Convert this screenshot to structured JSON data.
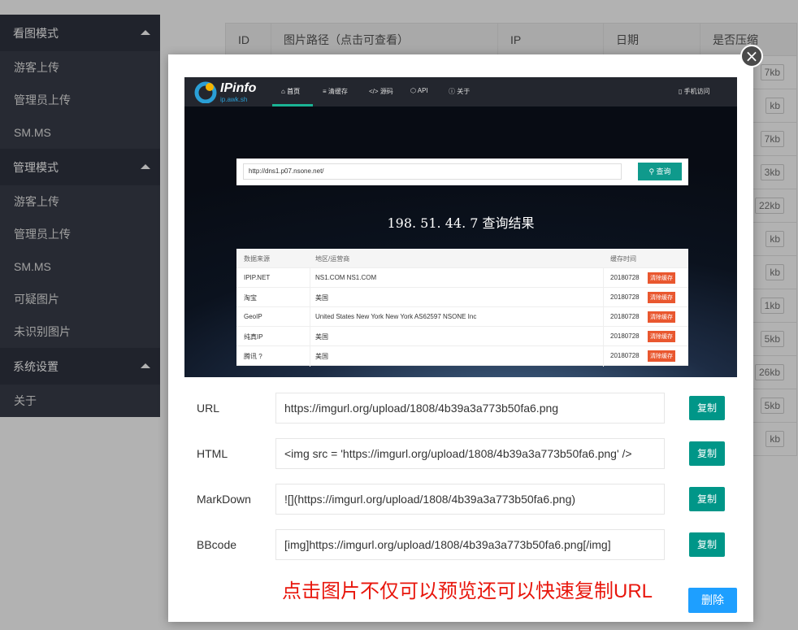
{
  "sidebar": {
    "groups": [
      {
        "title": "看图模式",
        "items": [
          "游客上传",
          "管理员上传",
          "SM.MS"
        ]
      },
      {
        "title": "管理模式",
        "items": [
          "游客上传",
          "管理员上传",
          "SM.MS",
          "可疑图片",
          "未识别图片"
        ]
      },
      {
        "title": "系统设置",
        "items": [
          "关于"
        ]
      }
    ]
  },
  "table": {
    "headers": [
      "ID",
      "图片路径（点击可查看）",
      "IP",
      "日期",
      "是否压缩"
    ],
    "size_tags": [
      "7kb",
      "kb",
      "7kb",
      "3kb",
      "22kb",
      "kb",
      "kb",
      "1kb",
      "5kb",
      "26kb",
      "5kb",
      "kb"
    ]
  },
  "modal": {
    "close_symbol": "×",
    "preview": {
      "brand": "IPinfo",
      "brand_sub": "ip.awk.sh",
      "nav_tabs": [
        "首页",
        "清缓存",
        "源码",
        "API",
        "关于"
      ],
      "nav_icons": [
        "⌂",
        "≡",
        "</>",
        "⬡",
        "ⓘ"
      ],
      "mobile_link": "手机访问",
      "mobile_icon": "▯",
      "search_value": "http://dns1.p07.nsone.net/",
      "search_button": "查询",
      "search_icon": "⚲",
      "result_ip": "198. 51. 44. 7",
      "result_suffix": "查询结果",
      "table_headers": [
        "数据来源",
        "地区/运营商",
        "缓存时间"
      ],
      "rows": [
        {
          "source": "IPIP.NET",
          "region": "NS1.COM NS1.COM",
          "date": "20180728",
          "action": "清除缓存"
        },
        {
          "source": "淘宝",
          "region": "美国",
          "date": "20180728",
          "action": "清除缓存"
        },
        {
          "source": "GeoIP",
          "region": "United States New York New York AS62597 NSONE Inc",
          "date": "20180728",
          "action": "清除缓存"
        },
        {
          "source": "纯真IP",
          "region": "美国",
          "date": "20180728",
          "action": "清除缓存"
        },
        {
          "source": "腾讯 ?",
          "region": "美国",
          "date": "20180728",
          "action": "清除缓存"
        }
      ]
    },
    "links": [
      {
        "label": "URL",
        "value": "https://imgurl.org/upload/1808/4b39a3a773b50fa6.png",
        "button": "复制"
      },
      {
        "label": "HTML",
        "value": "<img src = 'https://imgurl.org/upload/1808/4b39a3a773b50fa6.png' />",
        "button": "复制"
      },
      {
        "label": "MarkDown",
        "value": "![](https://imgurl.org/upload/1808/4b39a3a773b50fa6.png)",
        "button": "复制"
      },
      {
        "label": "BBcode",
        "value": "[img]https://imgurl.org/upload/1808/4b39a3a773b50fa6.png[/img]",
        "button": "复制"
      }
    ],
    "hint": "点击图片不仅可以预览还可以快速复制URL",
    "delete_button": "删除"
  },
  "colors": {
    "sidebar_bg": "#393d49",
    "sidebar_group_bg": "#2f3340",
    "copy_button": "#009688",
    "delete_button": "#1e9fff",
    "hint_text": "#e8160c",
    "preview_accent": "#0f9a8c",
    "clear_cache_tag": "#e9572f"
  }
}
